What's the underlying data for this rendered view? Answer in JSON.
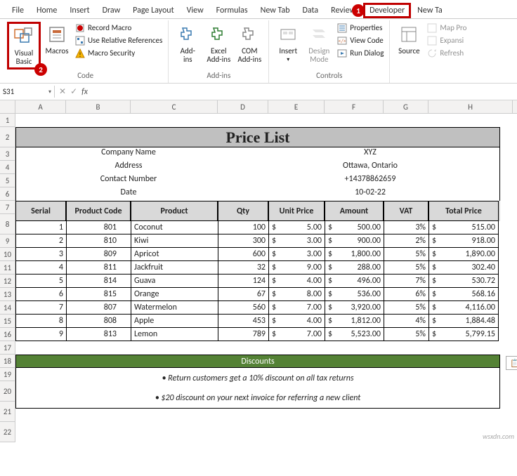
{
  "menu": {
    "tabs": [
      "File",
      "Home",
      "Insert",
      "Draw",
      "Page Layout",
      "View",
      "Formulas",
      "New Tab",
      "Data",
      "Review",
      "Developer",
      "New Ta"
    ]
  },
  "steps": {
    "s1": "1",
    "s2": "2"
  },
  "ribbon": {
    "code": {
      "visual_basic": "Visual\nBasic",
      "macros": "Macros",
      "record": "Record Macro",
      "relative": "Use Relative References",
      "security": "Macro Security",
      "label": "Code"
    },
    "addins": {
      "addins": "Add-\nins",
      "excel": "Excel\nAdd-ins",
      "com": "COM\nAdd-ins",
      "label": "Add-ins"
    },
    "controls": {
      "insert": "Insert",
      "design": "Design\nMode",
      "properties": "Properties",
      "viewcode": "View Code",
      "rundialog": "Run Dialog",
      "label": "Controls"
    },
    "xml": {
      "source": "Source",
      "mapprops": "Map Pro",
      "expansion": "Expansi",
      "refresh": "Refresh"
    }
  },
  "namebox": {
    "value": "S31"
  },
  "fx": {
    "label": "fx"
  },
  "colHeaders": [
    "A",
    "B",
    "C",
    "D",
    "E",
    "F",
    "G",
    "H"
  ],
  "rowHeaders": [
    "1",
    "2",
    "3",
    "4",
    "5",
    "6",
    "7",
    "8",
    "9",
    "10",
    "11",
    "12",
    "13",
    "14",
    "15",
    "16",
    "17",
    "18",
    "19",
    "20",
    "21",
    "22"
  ],
  "sheet": {
    "title": "Price List",
    "info": [
      {
        "label": "Company Name",
        "value": "XYZ"
      },
      {
        "label": "Address",
        "value": "Ottawa, Ontario"
      },
      {
        "label": "Contact Number",
        "value": "+14378862659"
      },
      {
        "label": "Date",
        "value": "10-02-22"
      }
    ],
    "headers": [
      "Serial",
      "Product Code",
      "Product",
      "Qty",
      "Unit Price",
      "Amount",
      "VAT",
      "Total Price"
    ],
    "rows": [
      {
        "serial": "1",
        "code": "801",
        "product": "Coconut",
        "qty": "100",
        "unit": "5.00",
        "amount": "500.00",
        "vat": "3%",
        "total": "515.00"
      },
      {
        "serial": "2",
        "code": "810",
        "product": "Kiwi",
        "qty": "300",
        "unit": "3.00",
        "amount": "900.00",
        "vat": "2%",
        "total": "918.00"
      },
      {
        "serial": "3",
        "code": "809",
        "product": "Apricot",
        "qty": "600",
        "unit": "3.00",
        "amount": "1,800.00",
        "vat": "5%",
        "total": "1,890.00"
      },
      {
        "serial": "4",
        "code": "811",
        "product": "Jackfruit",
        "qty": "32",
        "unit": "9.00",
        "amount": "288.00",
        "vat": "5%",
        "total": "302.40"
      },
      {
        "serial": "5",
        "code": "814",
        "product": "Guava",
        "qty": "124",
        "unit": "4.00",
        "amount": "496.00",
        "vat": "7%",
        "total": "530.72"
      },
      {
        "serial": "6",
        "code": "815",
        "product": "Orange",
        "qty": "67",
        "unit": "8.00",
        "amount": "536.00",
        "vat": "6%",
        "total": "568.16"
      },
      {
        "serial": "7",
        "code": "807",
        "product": "Watermelon",
        "qty": "560",
        "unit": "7.00",
        "amount": "3,920.00",
        "vat": "5%",
        "total": "4,116.00"
      },
      {
        "serial": "8",
        "code": "808",
        "product": "Apple",
        "qty": "453",
        "unit": "4.00",
        "amount": "1,812.00",
        "vat": "4%",
        "total": "1,884.48"
      },
      {
        "serial": "9",
        "code": "813",
        "product": "Lemon",
        "qty": "789",
        "unit": "7.00",
        "amount": "5,523.00",
        "vat": "5%",
        "total": "5,799.15"
      }
    ],
    "discount_header": "Discounts",
    "discount_lines": [
      "• Return customers get a 10% discount on all tax returns",
      "• $20 discount on your next invoice for referring a new client"
    ]
  },
  "watermark": "wsxdn.com",
  "currency": "$"
}
